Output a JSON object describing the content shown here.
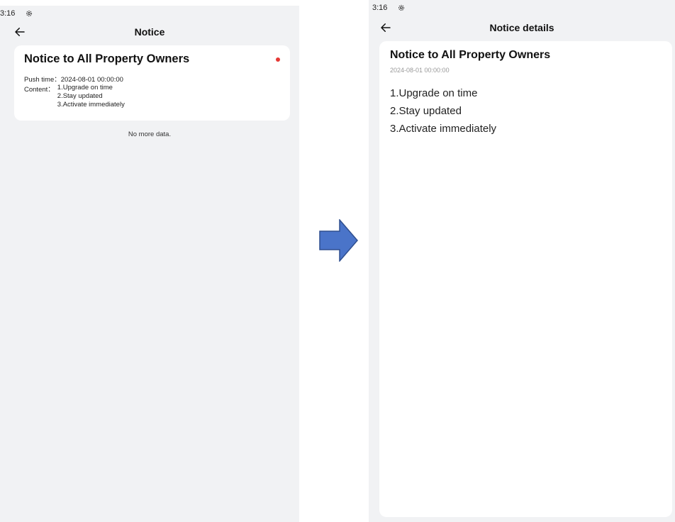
{
  "colors": {
    "screen_bg": "#f1f2f4",
    "card_bg": "#ffffff",
    "unread_dot": "#e53935",
    "arrow_fill": "#4a74c9",
    "arrow_stroke": "#2f4f8f"
  },
  "left_screen": {
    "status_bar": {
      "time": "3:16",
      "icon": "settings-gear-icon"
    },
    "header": {
      "back_icon": "back-arrow-icon",
      "title": "Notice"
    },
    "notice": {
      "title": "Notice to All Property Owners",
      "unread_indicator": "red-dot",
      "push_label": "Push time：",
      "push_time": "2024-08-01 00:00:00",
      "content_label": "Content：",
      "content_lines": [
        "1.Upgrade on time",
        "2.Stay updated",
        "3.Activate immediately"
      ]
    },
    "footer_text": "No more data."
  },
  "transition": {
    "icon": "right-arrow-icon"
  },
  "right_screen": {
    "status_bar": {
      "time": "3:16",
      "icon": "settings-gear-icon"
    },
    "header": {
      "back_icon": "back-arrow-icon",
      "title": "Notice details"
    },
    "detail": {
      "title": "Notice to All Property Owners",
      "time": "2024-08-01 00:00:00",
      "body_lines": [
        "1.Upgrade on time",
        "2.Stay updated",
        "3.Activate immediately"
      ]
    }
  }
}
